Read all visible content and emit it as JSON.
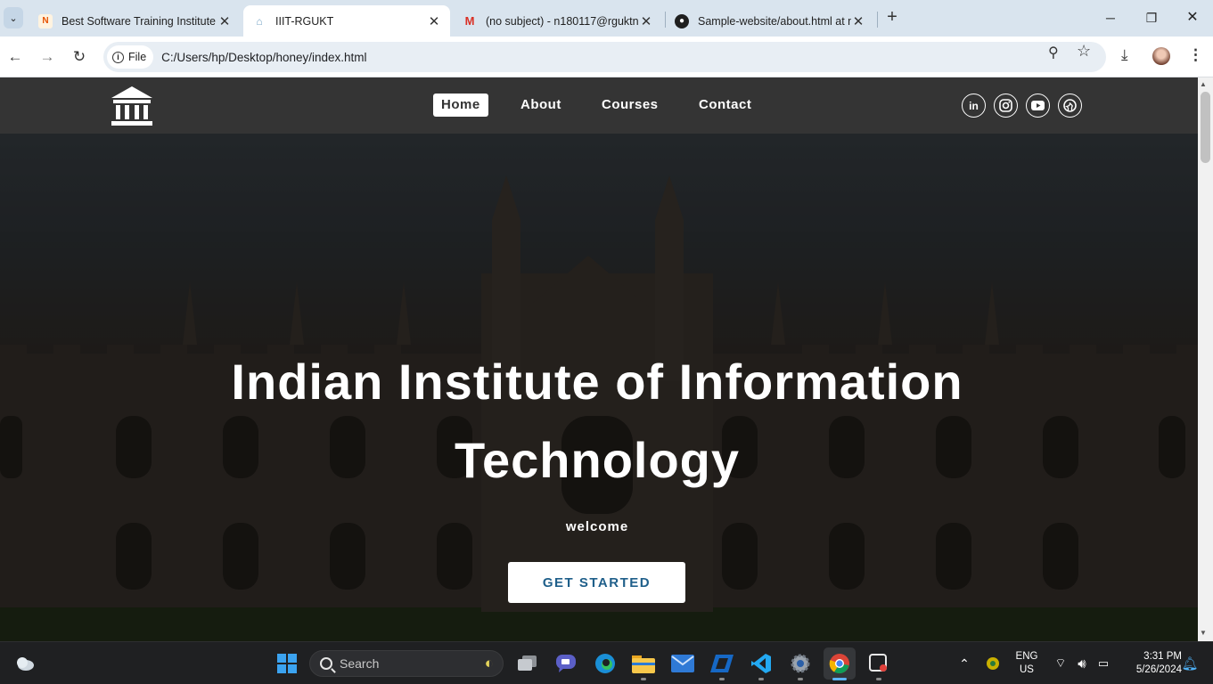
{
  "browser": {
    "tabs": [
      {
        "title": "Best Software Training Institute",
        "active": false
      },
      {
        "title": "IIIT-RGUKT",
        "active": true
      },
      {
        "title": "(no subject) - n180117@rguktn",
        "active": false
      },
      {
        "title": "Sample-website/about.html at m",
        "active": false
      }
    ],
    "omnibox": {
      "chip_label": "File",
      "url": "C:/Users/hp/Desktop/honey/index.html"
    }
  },
  "site": {
    "nav": {
      "items": [
        {
          "label": "Home",
          "active": true
        },
        {
          "label": "About",
          "active": false
        },
        {
          "label": "Courses",
          "active": false
        },
        {
          "label": "Contact",
          "active": false
        }
      ],
      "social_icons": [
        "linkedin-icon",
        "instagram-icon",
        "youtube-icon",
        "github-icon"
      ],
      "linkedin_glyph": "in"
    },
    "hero": {
      "title": "Indian Institute of Information Technology",
      "subtitle": "welcome",
      "cta_label": "GET STARTED"
    },
    "colors": {
      "navbar_bg": "#343434",
      "cta_text": "#1f5f8a"
    }
  },
  "taskbar": {
    "search_placeholder": "Search",
    "language_line1": "ENG",
    "language_line2": "US",
    "time": "3:31 PM",
    "date": "5/26/2024"
  }
}
